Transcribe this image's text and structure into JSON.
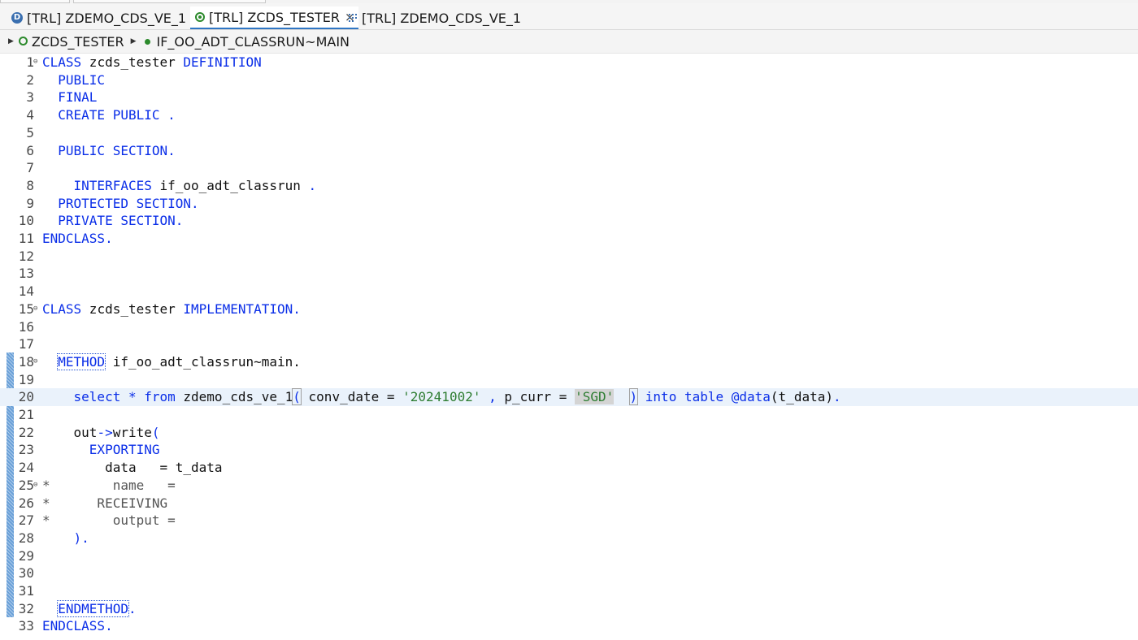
{
  "tabs": [
    {
      "label": "[TRL] ZDEMO_CDS_VE_1",
      "icon": "ddl-source-icon",
      "active": false
    },
    {
      "label": "[TRL] ZCDS_TESTER",
      "icon": "class-icon",
      "active": true,
      "close": "×"
    },
    {
      "label": "[TRL] ZDEMO_CDS_VE_1",
      "icon": "data-preview-icon",
      "active": false
    }
  ],
  "breadcrumb": {
    "class": "ZCDS_TESTER",
    "method": "IF_OO_ADT_CLASSRUN~MAIN"
  },
  "colors": {
    "keyword": "#0a2ee8",
    "string": "#2e7d32",
    "comment": "#555555",
    "current_line": "#eaf2fb",
    "ruler": "#6aa0d8"
  },
  "editor": {
    "lines": [
      {
        "n": "1",
        "fold": true,
        "tokens": [
          {
            "t": "CLASS",
            "c": "kw"
          },
          {
            "t": " zcds_tester ",
            "c": "id"
          },
          {
            "t": "DEFINITION",
            "c": "kw"
          }
        ]
      },
      {
        "n": "2",
        "tokens": [
          {
            "t": "  PUBLIC",
            "c": "kw"
          }
        ]
      },
      {
        "n": "3",
        "tokens": [
          {
            "t": "  FINAL",
            "c": "kw"
          }
        ]
      },
      {
        "n": "4",
        "tokens": [
          {
            "t": "  CREATE PUBLIC .",
            "c": "kw"
          }
        ]
      },
      {
        "n": "5",
        "tokens": []
      },
      {
        "n": "6",
        "tokens": [
          {
            "t": "  PUBLIC SECTION.",
            "c": "kw"
          }
        ]
      },
      {
        "n": "7",
        "tokens": []
      },
      {
        "n": "8",
        "tokens": [
          {
            "t": "    INTERFACES",
            "c": "kw"
          },
          {
            "t": " if_oo_adt_classrun ",
            "c": "id"
          },
          {
            "t": ".",
            "c": "kw"
          }
        ]
      },
      {
        "n": "9",
        "tokens": [
          {
            "t": "  PROTECTED SECTION.",
            "c": "kw"
          }
        ]
      },
      {
        "n": "10",
        "tokens": [
          {
            "t": "  PRIVATE SECTION.",
            "c": "kw"
          }
        ]
      },
      {
        "n": "11",
        "tokens": [
          {
            "t": "ENDCLASS.",
            "c": "kw"
          }
        ]
      },
      {
        "n": "12",
        "tokens": []
      },
      {
        "n": "13",
        "tokens": []
      },
      {
        "n": "14",
        "tokens": []
      },
      {
        "n": "15",
        "fold": true,
        "tokens": [
          {
            "t": "CLASS",
            "c": "kw"
          },
          {
            "t": " zcds_tester ",
            "c": "id"
          },
          {
            "t": "IMPLEMENTATION.",
            "c": "kw"
          }
        ]
      },
      {
        "n": "16",
        "tokens": []
      },
      {
        "n": "17",
        "tokens": []
      },
      {
        "n": "18",
        "fold": true,
        "tokens": [
          {
            "t": "  ",
            "c": "id"
          },
          {
            "t": "METHOD",
            "c": "kw boxed"
          },
          {
            "t": " if_oo_adt_classrun~main.",
            "c": "id"
          }
        ]
      },
      {
        "n": "19",
        "tokens": []
      },
      {
        "n": "20",
        "current": true,
        "tokens": [
          {
            "t": "    select * from",
            "c": "kw"
          },
          {
            "t": " zdemo_cds_ve_1",
            "c": "id"
          },
          {
            "t": "(",
            "c": "kw bracket"
          },
          {
            "t": " conv_date = ",
            "c": "id"
          },
          {
            "t": "'20241002'",
            "c": "str"
          },
          {
            "t": " , ",
            "c": "kw"
          },
          {
            "t": "p_curr = ",
            "c": "id"
          },
          {
            "t": "'SGD'",
            "c": "str hl"
          },
          {
            "t": "  ",
            "c": "id"
          },
          {
            "t": ")",
            "c": "kw bracket"
          },
          {
            "t": " into table @",
            "c": "kw"
          },
          {
            "t": "data",
            "c": "kw"
          },
          {
            "t": "(t_data)",
            "c": "id"
          },
          {
            "t": ".",
            "c": "kw"
          }
        ]
      },
      {
        "n": "21",
        "tokens": []
      },
      {
        "n": "22",
        "tokens": [
          {
            "t": "    out",
            "c": "id"
          },
          {
            "t": "->",
            "c": "kw"
          },
          {
            "t": "write",
            "c": "id"
          },
          {
            "t": "(",
            "c": "kw"
          }
        ]
      },
      {
        "n": "23",
        "tokens": [
          {
            "t": "      EXPORTING",
            "c": "kw"
          }
        ]
      },
      {
        "n": "24",
        "tokens": [
          {
            "t": "        data   = t_data",
            "c": "id"
          }
        ]
      },
      {
        "n": "25",
        "fold": true,
        "tokens": [
          {
            "t": "*        name   =",
            "c": "cm"
          }
        ]
      },
      {
        "n": "26",
        "tokens": [
          {
            "t": "*      RECEIVING",
            "c": "cm"
          }
        ]
      },
      {
        "n": "27",
        "tokens": [
          {
            "t": "*        output =",
            "c": "cm"
          }
        ]
      },
      {
        "n": "28",
        "tokens": [
          {
            "t": "    ).",
            "c": "kw"
          }
        ]
      },
      {
        "n": "29",
        "tokens": []
      },
      {
        "n": "30",
        "tokens": []
      },
      {
        "n": "31",
        "tokens": []
      },
      {
        "n": "32",
        "tokens": [
          {
            "t": "  ",
            "c": "id"
          },
          {
            "t": "ENDMETHOD",
            "c": "kw boxed"
          },
          {
            "t": ".",
            "c": "kw"
          }
        ]
      },
      {
        "n": "33",
        "tokens": [
          {
            "t": "ENDCLASS.",
            "c": "kw"
          }
        ]
      }
    ]
  }
}
